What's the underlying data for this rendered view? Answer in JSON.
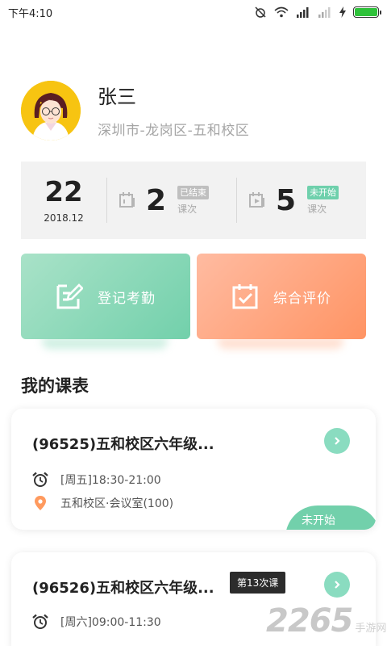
{
  "status_bar": {
    "time": "下午4:10"
  },
  "profile": {
    "name": "张三",
    "school": "深圳市-龙岗区-五和校区"
  },
  "stats": {
    "day": "22",
    "month": "2018.12",
    "finished": {
      "count": "2",
      "badge": "已结束",
      "unit": "课次"
    },
    "pending": {
      "count": "5",
      "badge": "未开始",
      "unit": "课次"
    }
  },
  "actions": {
    "attendance": "登记考勤",
    "evaluation": "综合评价"
  },
  "schedule": {
    "title": "我的课表",
    "courses": [
      {
        "title": "(96525)五和校区六年级...",
        "time": "[周五]18:30-21:00",
        "location": "五和校区·会议室(100)",
        "status": "未开始"
      },
      {
        "title": "(96526)五和校区六年级...",
        "badge": "第13次课",
        "time": "[周六]09:00-11:30"
      }
    ]
  },
  "watermark": {
    "number": "2265",
    "sub": "手游网"
  },
  "colors": {
    "accent_green": "#72d0ab",
    "accent_orange": "#ff9464",
    "battery": "#2ec23a"
  }
}
